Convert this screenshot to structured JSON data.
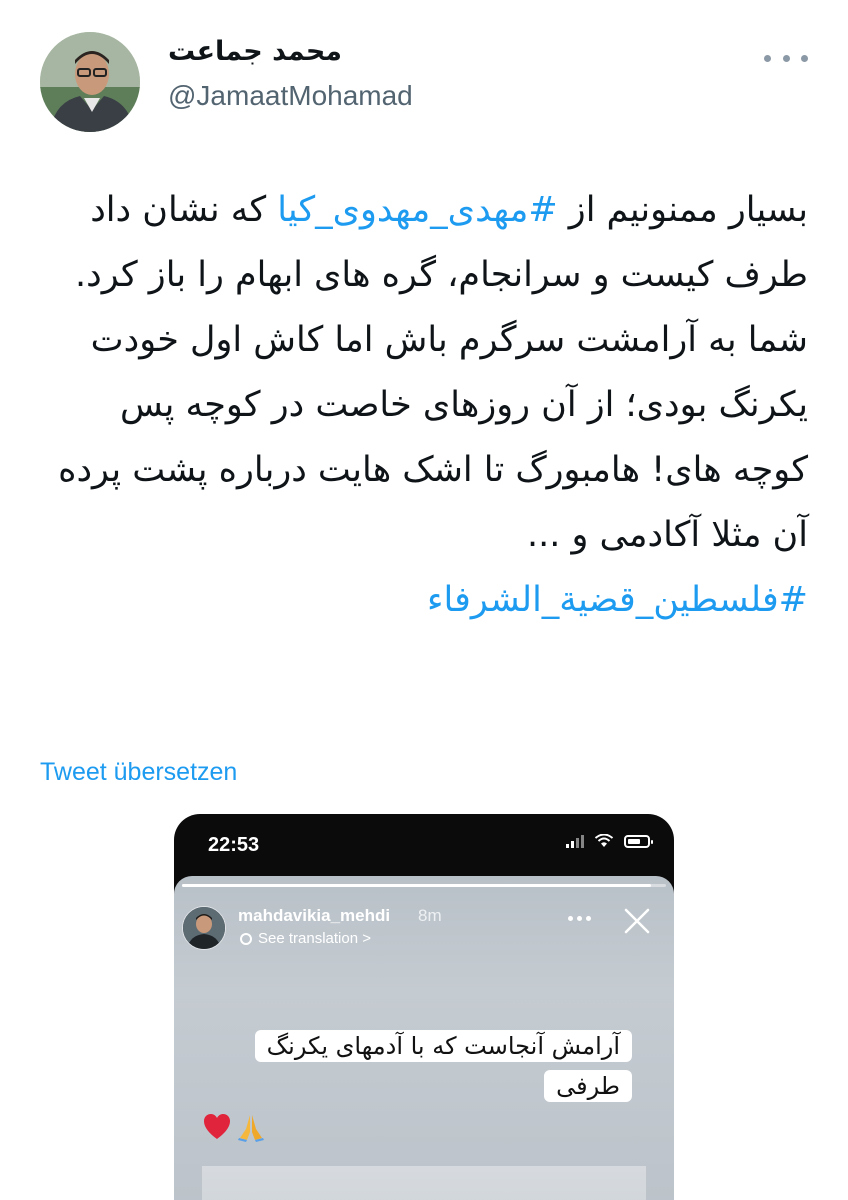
{
  "author": {
    "display_name": "محمد جماعت",
    "handle": "@JamaatMohamad"
  },
  "tweet": {
    "paragraph1_part1": "بسیار ممنونیم از ",
    "hashtag1": "#مهدی_مهدوی_کیا",
    "paragraph1_part2": " که نشان داد طرف کیست و سرانجام، گره های ابهام را باز کرد.",
    "paragraph2": "شما به آرامشت سرگرم باش اما کاش اول خودت یکرنگ بودی؛ از آن روزهای خاصت در کوچه پس کوچه های! هامبورگ تا اشک هایت درباره پشت پرده آن مثلا آکادمی و ...",
    "hashtag2": "#فلسطين_قضية_الشرفاء"
  },
  "translate_label": "Tweet übersetzen",
  "media": {
    "status_time": "22:53",
    "story_username": "mahdavikia_mehdi",
    "story_age": "8m",
    "see_translation": "See translation >",
    "story_progress": 0.97,
    "sticker_line1": "آرامش آنجاست که با آدمهای یکرنگ",
    "sticker_line2": "طرفی",
    "emojis": [
      "heart-icon",
      "folded-hands-icon"
    ]
  },
  "colors": {
    "link": "#1d9bf0",
    "handle": "#536471",
    "text": "#0f1419"
  }
}
